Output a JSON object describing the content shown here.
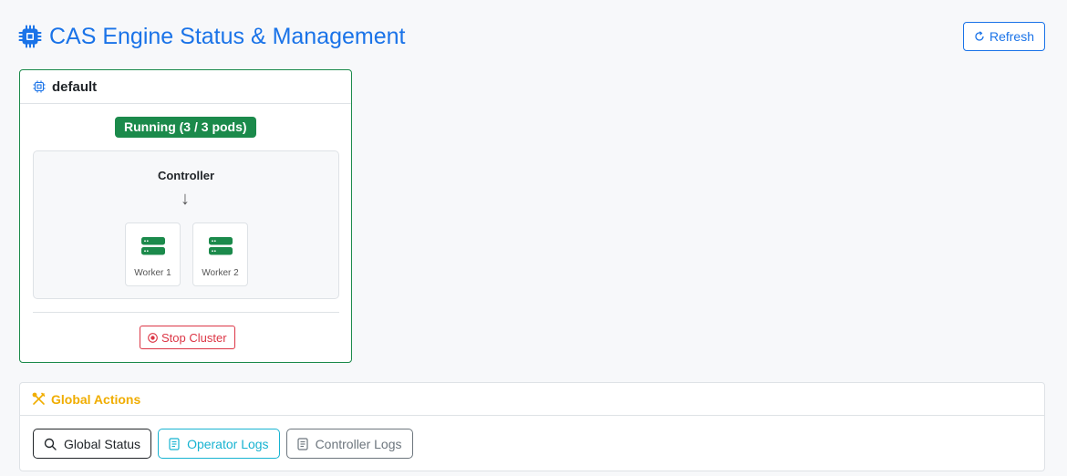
{
  "header": {
    "title": "CAS Engine Status & Management",
    "icon": "cpu-icon",
    "refresh_label": "Refresh",
    "accent_color": "#1a73e8"
  },
  "cluster": {
    "name": "default",
    "status": "Running (3 / 3 pods)",
    "status_color": "#1b8a4b",
    "controller_label": "Controller",
    "workers": [
      {
        "label": "Worker 1"
      },
      {
        "label": "Worker 2"
      }
    ],
    "stop_label": "Stop Cluster"
  },
  "global_actions": {
    "title": "Global Actions",
    "title_color": "#f0ad00",
    "buttons": [
      {
        "label": "Global Status",
        "icon": "search-icon"
      },
      {
        "label": "Operator Logs",
        "icon": "document-icon"
      },
      {
        "label": "Controller Logs",
        "icon": "document-icon"
      }
    ]
  }
}
